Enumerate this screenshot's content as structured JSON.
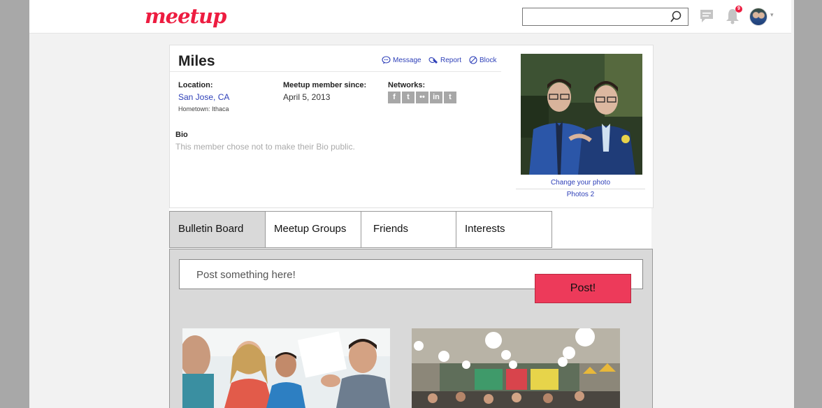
{
  "header": {
    "logo_text": "meetup",
    "search": {
      "placeholder": "",
      "value": ""
    },
    "notifications": {
      "count": "9"
    },
    "brand_color": "#ed1c40"
  },
  "profile": {
    "name": "Miles",
    "actions": [
      {
        "label": "Message",
        "icon": "message-icon"
      },
      {
        "label": "Report",
        "icon": "report-icon"
      },
      {
        "label": "Block",
        "icon": "block-icon"
      }
    ],
    "location_label": "Location:",
    "location_value": "San Jose, CA",
    "hometown": "Hometown: Ithaca",
    "member_since_label": "Meetup member since:",
    "member_since_value": "April 5, 2013",
    "networks_label": "Networks:",
    "networks": [
      {
        "name": "facebook-icon",
        "glyph": "f"
      },
      {
        "name": "twitter-icon",
        "glyph": "t"
      },
      {
        "name": "flickr-icon",
        "glyph": "••"
      },
      {
        "name": "linkedin-icon",
        "glyph": "in"
      },
      {
        "name": "tumblr-icon",
        "glyph": "t"
      }
    ],
    "bio_label": "Bio",
    "bio_text": "This member chose not to make their Bio public.",
    "change_photo": "Change your photo",
    "photos": "Photos 2"
  },
  "tabs": [
    {
      "label": "Bulletin Board",
      "active": true
    },
    {
      "label": "Meetup Groups",
      "active": false
    },
    {
      "label": "Friends",
      "active": false
    },
    {
      "label": "Interests",
      "active": false
    }
  ],
  "bulletin": {
    "post_placeholder": "Post something here!",
    "post_button": "Post!",
    "post_button_color": "#ed3a5a"
  }
}
